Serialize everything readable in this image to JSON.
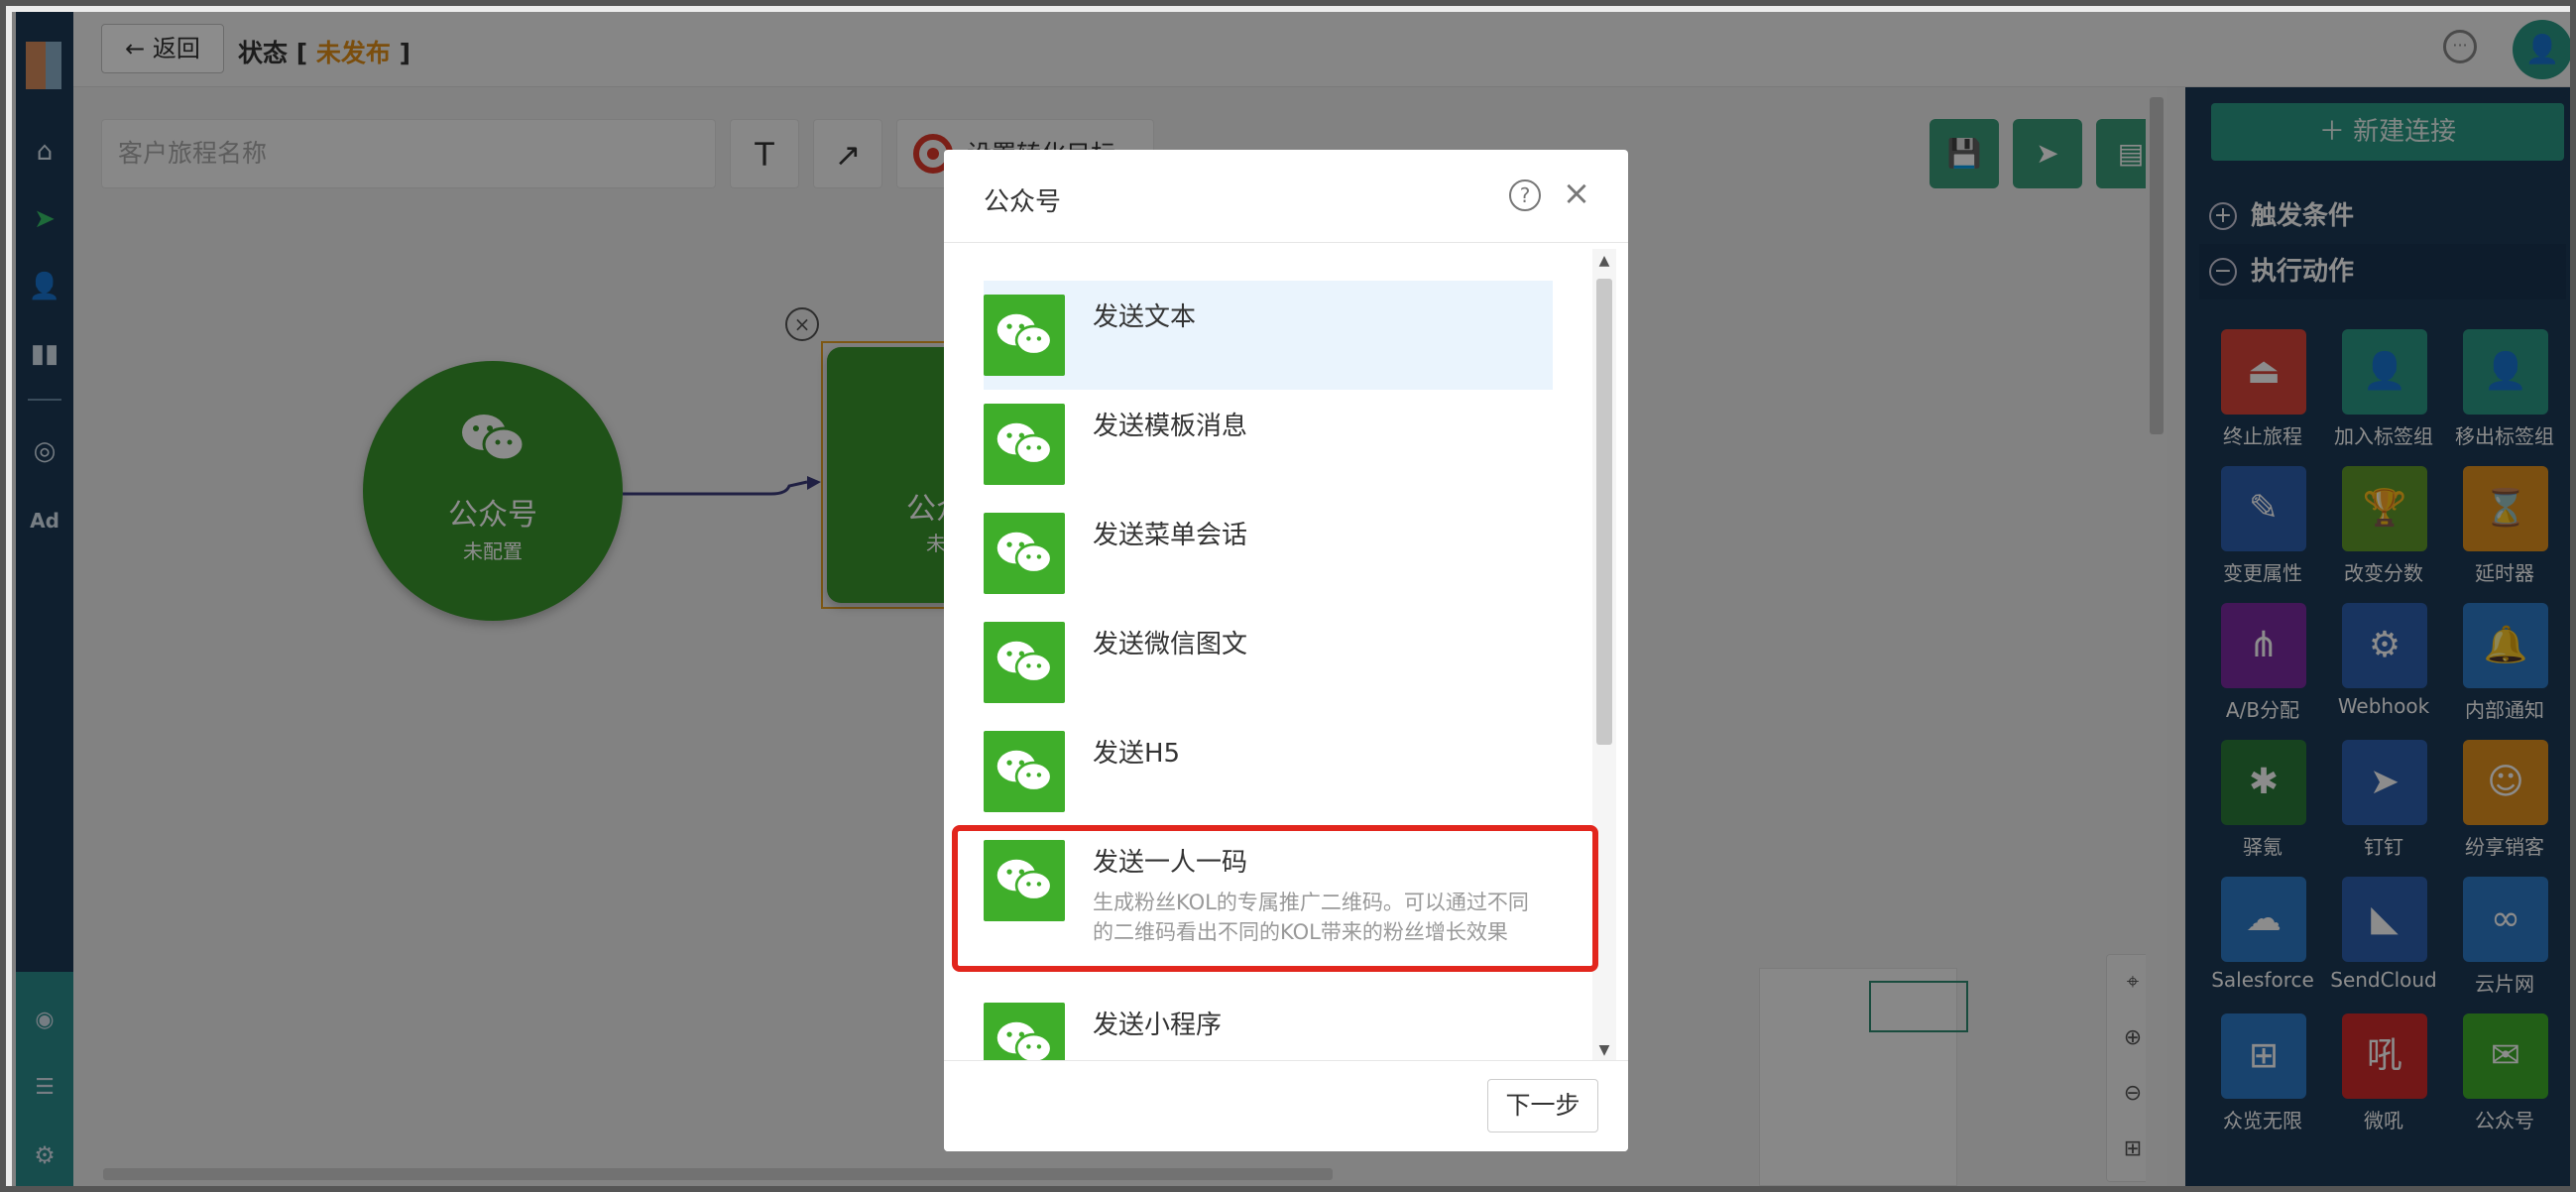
{
  "topbar": {
    "back_label": "← 返回",
    "status_prefix": "状态 [ ",
    "status_value": "未发布",
    "status_suffix": " ]"
  },
  "nav": {
    "icons": [
      "home-icon",
      "send-icon",
      "user-icon",
      "chart-icon",
      "wechat-icon",
      "ad-icon",
      "target-icon",
      "server-icon",
      "gear-icon"
    ],
    "ad_label": "Ad"
  },
  "canvas": {
    "journey_name_placeholder": "客户旅程名称",
    "text_tool": "T",
    "arrow_tool": "↗",
    "goal_label": "设置转化目标",
    "node1": {
      "title": "公众号",
      "subtitle": "未配置"
    },
    "node2": {
      "title": "公众号",
      "subtitle": "未配置"
    }
  },
  "right_panel": {
    "new_connection": "＋ 新建连接",
    "trigger_section": "触发条件",
    "action_section": "执行动作",
    "actions": [
      {
        "label": "终止旅程",
        "color": "#d9443a",
        "icon": "⏏"
      },
      {
        "label": "加入标签组",
        "color": "#2a9a86",
        "icon": "👤"
      },
      {
        "label": "移出标签组",
        "color": "#2a9a86",
        "icon": "👤"
      },
      {
        "label": "变更属性",
        "color": "#2c5fb0",
        "icon": "✎"
      },
      {
        "label": "改变分数",
        "color": "#5f9a2b",
        "icon": "🏆"
      },
      {
        "label": "延时器",
        "color": "#e0901e",
        "icon": "⌛"
      },
      {
        "label": "A/B分配",
        "color": "#7a2aa0",
        "icon": "⋔"
      },
      {
        "label": "Webhook",
        "color": "#2c5fb0",
        "icon": "⚙"
      },
      {
        "label": "内部通知",
        "color": "#2c7ac8",
        "icon": "🔔"
      },
      {
        "label": "驿氪",
        "color": "#2a7a3a",
        "icon": "✱"
      },
      {
        "label": "钉钉",
        "color": "#2c5fb0",
        "icon": "➤"
      },
      {
        "label": "纷享销客",
        "color": "#e0901e",
        "icon": "☺"
      },
      {
        "label": "Salesforce",
        "color": "#2c7ac8",
        "icon": "☁"
      },
      {
        "label": "SendCloud",
        "color": "#2c5fb0",
        "icon": "◣"
      },
      {
        "label": "云片网",
        "color": "#2c7ac8",
        "icon": "∞"
      },
      {
        "label": "众览无限",
        "color": "#2c7ac8",
        "icon": "⊞"
      },
      {
        "label": "微吼",
        "color": "#d02a2a",
        "icon": "吼"
      },
      {
        "label": "公众号",
        "color": "#3fae2a",
        "icon": "✉"
      }
    ]
  },
  "modal": {
    "title": "公众号",
    "items": [
      {
        "title": "发送文本",
        "desc": ""
      },
      {
        "title": "发送模板消息",
        "desc": ""
      },
      {
        "title": "发送菜单会话",
        "desc": ""
      },
      {
        "title": "发送微信图文",
        "desc": ""
      },
      {
        "title": "发送H5",
        "desc": ""
      },
      {
        "title": "发送一人一码",
        "desc": "生成粉丝KOL的专属推广二维码。可以通过不同的二维码看出不同的KOL带来的粉丝增长效果"
      },
      {
        "title": "发送小程序",
        "desc": ""
      }
    ],
    "next_label": "下一步"
  }
}
